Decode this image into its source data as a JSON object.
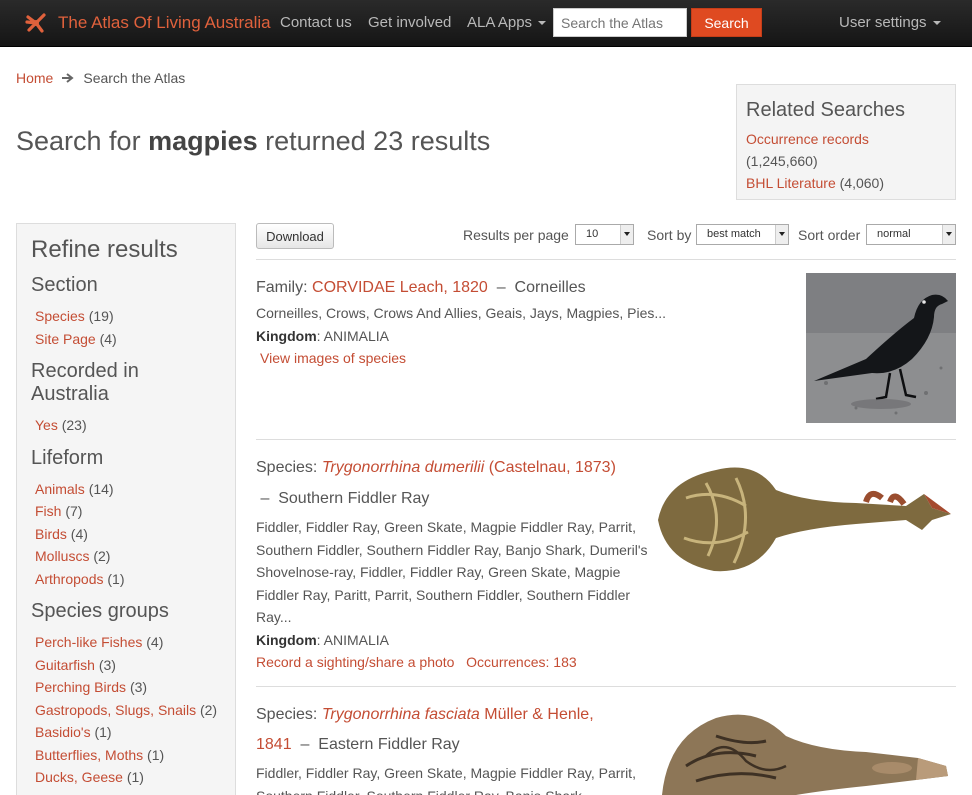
{
  "navbar": {
    "brand": "The Atlas Of Living Australia",
    "links": [
      "Contact us",
      "Get involved",
      "ALA Apps"
    ],
    "search_placeholder": "Search the Atlas",
    "search_button": "Search",
    "user_settings": "User settings"
  },
  "breadcrumb": {
    "home": "Home",
    "current": "Search the Atlas"
  },
  "title": {
    "prefix": "Search for ",
    "query": "magpies",
    "suffix": " returned 23 results"
  },
  "related": {
    "heading": "Related Searches",
    "occurrence_label": "Occurrence records",
    "occurrence_count": "(1,245,660)",
    "bhl_label": "BHL Literature",
    "bhl_count": "(4,060)"
  },
  "sidebar": {
    "heading": "Refine results",
    "groups": [
      {
        "title": "Section",
        "items": [
          {
            "label": "Species",
            "count": "(19)"
          },
          {
            "label": "Site Page",
            "count": "(4)"
          }
        ]
      },
      {
        "title": "Recorded in Australia",
        "items": [
          {
            "label": "Yes",
            "count": "(23)"
          }
        ]
      },
      {
        "title": "Lifeform",
        "items": [
          {
            "label": "Animals",
            "count": "(14)"
          },
          {
            "label": "Fish",
            "count": "(7)"
          },
          {
            "label": "Birds",
            "count": "(4)"
          },
          {
            "label": "Molluscs",
            "count": "(2)"
          },
          {
            "label": "Arthropods",
            "count": "(1)"
          }
        ]
      },
      {
        "title": "Species groups",
        "items": [
          {
            "label": "Perch-like Fishes",
            "count": "(4)"
          },
          {
            "label": "Guitarfish",
            "count": "(3)"
          },
          {
            "label": "Perching Birds",
            "count": "(3)"
          },
          {
            "label": "Gastropods, Slugs, Snails",
            "count": "(2)"
          },
          {
            "label": "Basidio's",
            "count": "(1)"
          },
          {
            "label": "Butterflies, Moths",
            "count": "(1)"
          },
          {
            "label": "Ducks, Geese",
            "count": "(1)"
          }
        ]
      }
    ]
  },
  "controls": {
    "download": "Download",
    "per_page_label": "Results per page",
    "per_page_value": "10",
    "sort_by_label": "Sort by",
    "sort_by_value": "best match",
    "sort_order_label": "Sort order",
    "sort_order_value": "normal"
  },
  "results": [
    {
      "rank": "Family:",
      "name": "CORVIDAE Leach, 1820",
      "common": "Corneilles",
      "synonyms": "Corneilles, Crows, Crows And Allies, Geais, Jays, Magpies, Pies...",
      "kingdom_label": "Kingdom",
      "kingdom": ": ANIMALIA",
      "link": "View images of species"
    },
    {
      "rank": "Species:",
      "name_italic": "Trygonorrhina dumerilii",
      "author": " (Castelnau, 1873)",
      "common": "Southern Fiddler Ray",
      "synonyms": "Fiddler, Fiddler Ray, Green Skate, Magpie Fiddler Ray, Parrit, Southern Fiddler, Southern Fiddler Ray, Banjo Shark, Dumeril's Shovelnose-ray, Fiddler, Fiddler Ray, Green Skate, Magpie Fiddler Ray, Paritt, Parrit, Southern Fiddler, Southern Fiddler Ray...",
      "kingdom_label": "Kingdom",
      "kingdom": ": ANIMALIA",
      "link_record": "Record a sighting/share a photo",
      "link_occ": "Occurrences: 183"
    },
    {
      "rank": "Species:",
      "name_italic": "Trygonorrhina fasciata",
      "author": " Müller & Henle,",
      "author2": "1841",
      "common": "Eastern Fiddler Ray",
      "synonyms": "Fiddler, Fiddler Ray, Green Skate, Magpie Fiddler Ray, Parrit, Southern Fiddler, Southern Fiddler Ray, Banjo Shark"
    }
  ]
}
